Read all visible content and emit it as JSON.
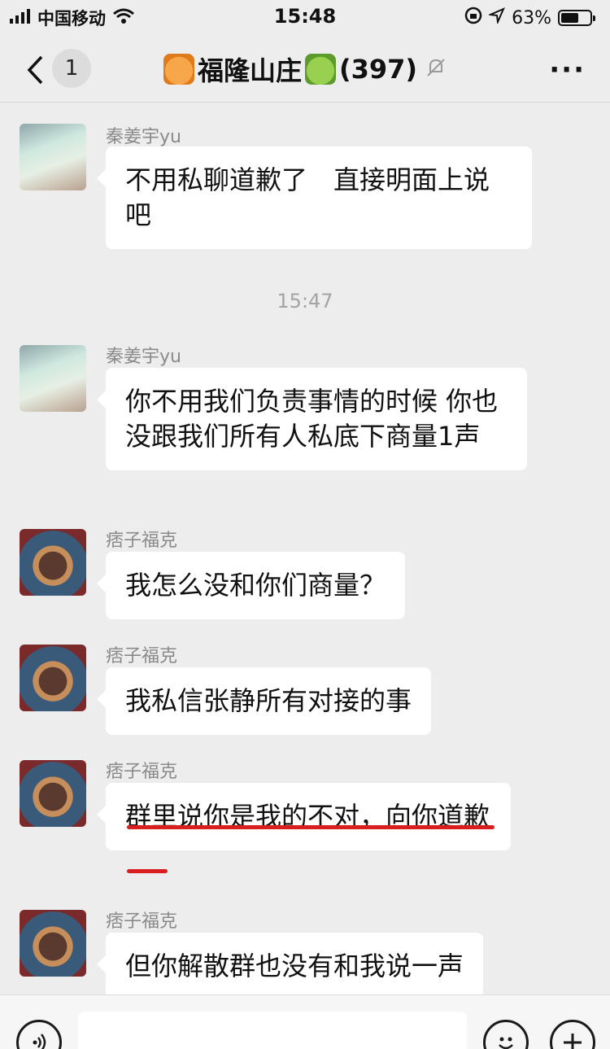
{
  "status_bar": {
    "carrier": "中国移动",
    "time": "15:48",
    "battery": "63%",
    "battery_level": 0.63
  },
  "nav": {
    "unread_count": "1",
    "title": "福隆山庄",
    "member_count": "(397)",
    "more": "···"
  },
  "messages": [
    {
      "sender": "秦姜宇yu",
      "text": "不用私聊道歉了　直接明面上说吧"
    },
    {
      "sender": "秦姜宇yu",
      "text": "你不用我们负责事情的时候 你也没跟我们所有人私底下商量1声"
    },
    {
      "sender": "痞子福克",
      "text": "我怎么没和你们商量？"
    },
    {
      "sender": "痞子福克",
      "text": "我私信张静所有对接的事"
    },
    {
      "sender": "痞子福克",
      "text": "群里说你是我的不对，向你道歉"
    },
    {
      "sender": "痞子福克",
      "text": "但你解散群也没有和我说一声"
    }
  ],
  "timestamp": "15:47",
  "input_bar": {
    "placeholder": ""
  },
  "colors": {
    "background": "#ededed",
    "bubble": "#ffffff",
    "underline": "#d81e1e"
  }
}
